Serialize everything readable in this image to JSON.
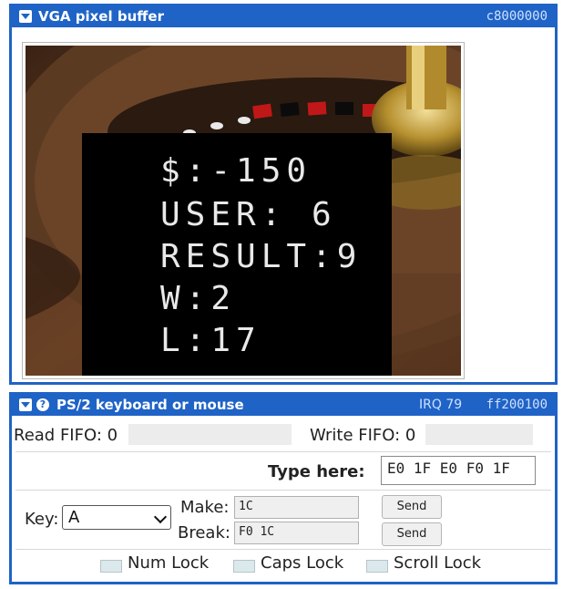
{
  "vga": {
    "title": "VGA pixel buffer",
    "address": "c8000000",
    "screen_lines": [
      "$:-150",
      "USER: 6",
      "RESULT:9",
      "W:2",
      "L:17"
    ]
  },
  "ps2": {
    "title": "PS/2 keyboard or mouse",
    "irq": "IRQ 79",
    "address": "ff200100",
    "read_fifo_label": "Read FIFO: 0",
    "write_fifo_label": "Write FIFO: 0",
    "type_here_label": "Type here:",
    "type_here_value": "E0 1F E0 F0 1F",
    "key_label": "Key:",
    "key_selected": "A",
    "make_label": "Make:",
    "make_value": "1C",
    "break_label": "Break:",
    "break_value": "F0 1C",
    "send_label": "Send",
    "locks": [
      "Num Lock",
      "Caps Lock",
      "Scroll Lock"
    ]
  },
  "colors": {
    "accent": "#1f63c6",
    "led_off": "#dce9ec"
  }
}
